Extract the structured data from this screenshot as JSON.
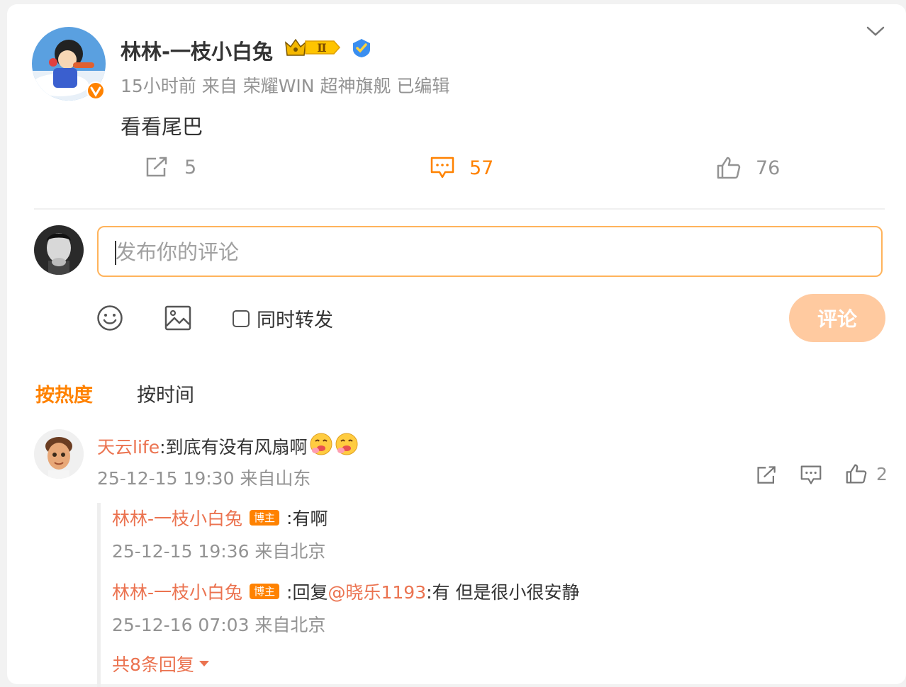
{
  "post": {
    "author_name": "林林-一枝小白兔",
    "level_badge": "Ⅱ",
    "meta": "15小时前  来自 荣耀WIN 超神旗舰 已编辑",
    "text": "看看尾巴",
    "actions": {
      "repost_count": "5",
      "comment_count": "57",
      "like_count": "76"
    }
  },
  "composer": {
    "placeholder": "发布你的评论",
    "sync_repost_label": "同时转发",
    "submit_label": "评论"
  },
  "sort_tabs": {
    "hot": "按热度",
    "time": "按时间"
  },
  "comment": {
    "user": "天云life",
    "text": ":到底有没有风扇啊",
    "meta": "25-12-15 19:30 来自山东",
    "like_count": "2",
    "replies": [
      {
        "user": "林林-一枝小白兔",
        "badge": "博主",
        "prefix": ":",
        "text": "有啊",
        "meta": "25-12-15 19:36 来自北京"
      },
      {
        "user": "林林-一枝小白兔",
        "badge": "博主",
        "prefix": ":回复",
        "mention": "@晓乐1193",
        "text": ":有 但是很小很安静",
        "meta": "25-12-16 07:03 来自北京"
      }
    ],
    "more_replies": "共8条回复"
  },
  "colors": {
    "accent": "#ff8200",
    "link": "#eb7350",
    "muted": "#939393",
    "submit_disabled": "#ffcaa0"
  }
}
